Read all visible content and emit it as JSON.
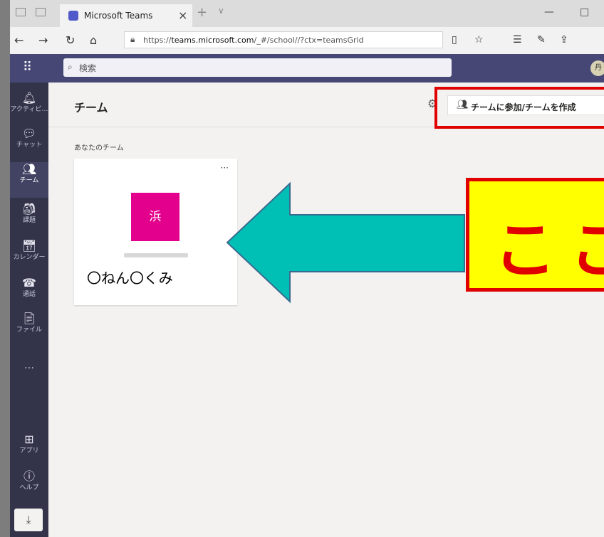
{
  "browser": {
    "tab_title": "Microsoft Teams",
    "tab_close": "×",
    "new_tab": "+",
    "tab_dropdown": "∨",
    "url_prefix": "https://",
    "url_host": "teams.microsoft.com",
    "url_path": "/_#/school//?ctx=teamsGrid",
    "minimize": "—",
    "maximize": "□",
    "close": "×"
  },
  "teams_header": {
    "search_placeholder": "検索",
    "avatar_initial": "丹"
  },
  "rail": {
    "items": [
      {
        "label": "アクティビ…"
      },
      {
        "label": "チャット"
      },
      {
        "label": "チーム"
      },
      {
        "label": "課題"
      },
      {
        "label": "カレンダー"
      },
      {
        "label": "通話"
      },
      {
        "label": "ファイル"
      },
      {
        "label": "…"
      },
      {
        "label": "アプリ"
      },
      {
        "label": "ヘルプ"
      }
    ],
    "active": "チーム"
  },
  "main": {
    "page_title": "チーム",
    "join_button": "チームに参加/チームを作成",
    "section_title": "あなたのチーム",
    "team_card": {
      "tile_char": "浜",
      "more": "···"
    }
  },
  "annotations": {
    "card_label": "〇ねん〇くみ",
    "callout_text": "ここ",
    "arrow_color": "#00c0b6",
    "highlight_color": "#e00000",
    "callout_bg": "#ffff00"
  }
}
